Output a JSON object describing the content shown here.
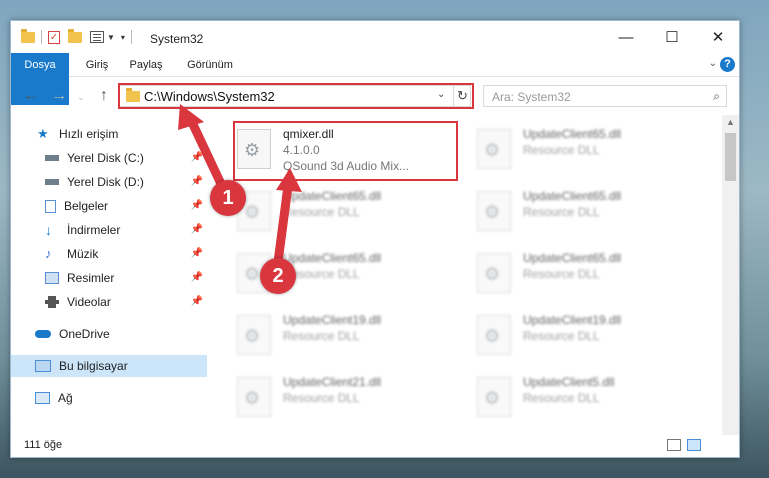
{
  "window": {
    "title": "System32",
    "controls": {
      "minimize": "—",
      "maximize": "☐",
      "close": "✕"
    }
  },
  "ribbon": {
    "tabs": [
      {
        "label": "Dosya",
        "active": true
      },
      {
        "label": "Giriş"
      },
      {
        "label": "Paylaş"
      },
      {
        "label": "Görünüm"
      }
    ],
    "help": "?"
  },
  "navigation": {
    "back": "←",
    "forward": "→",
    "up": "↑",
    "address": "C:\\Windows\\System32",
    "dropdown": "⌄",
    "refresh": "↻",
    "search_placeholder": "Ara: System32",
    "search_icon": "⌕"
  },
  "sidebar": {
    "items": [
      {
        "label": "Hızlı erişim",
        "icon": "star-icon",
        "color": "#1979ca",
        "pinned": false
      },
      {
        "label": "Yerel Disk (C:)",
        "icon": "drive-icon",
        "color": "#6d7f8c",
        "pinned": true
      },
      {
        "label": "Yerel Disk (D:)",
        "icon": "drive-icon",
        "color": "#6d7f8c",
        "pinned": true
      },
      {
        "label": "Belgeler",
        "icon": "document-icon",
        "color": "#5a8fd0",
        "pinned": true
      },
      {
        "label": "İndirmeler",
        "icon": "download-icon",
        "color": "#1979ca",
        "pinned": true
      },
      {
        "label": "Müzik",
        "icon": "music-icon",
        "color": "#3a7bd5",
        "pinned": true
      },
      {
        "label": "Resimler",
        "icon": "picture-icon",
        "color": "#5a8fd0",
        "pinned": true
      },
      {
        "label": "Videolar",
        "icon": "video-icon",
        "color": "#555555",
        "pinned": true
      },
      {
        "label": "OneDrive",
        "icon": "cloud-icon",
        "color": "#1979ca",
        "pinned": false
      },
      {
        "label": "Bu bilgisayar",
        "icon": "computer-icon",
        "color": "#4a90d9",
        "pinned": false,
        "selected": true
      },
      {
        "label": "Ağ",
        "icon": "network-icon",
        "color": "#4a90d9",
        "pinned": false
      }
    ]
  },
  "files": [
    {
      "name": "qmixer.dll",
      "version": "4.1.0.0",
      "desc": "QSound 3d Audio Mix...",
      "highlighted": true
    },
    {
      "name": "UpdateClient65.dll",
      "desc": "Resource DLL"
    },
    {
      "name": "UpdateClient65.dll",
      "desc": "Resource DLL"
    },
    {
      "name": "UpdateClient65.dll",
      "desc": "Resource DLL"
    },
    {
      "name": "UpdateClient65.dll",
      "desc": "Resource DLL"
    },
    {
      "name": "UpdateClient65.dll",
      "desc": "Resource DLL"
    },
    {
      "name": "UpdateClient19.dll",
      "desc": "Resource DLL"
    },
    {
      "name": "UpdateClient19.dll",
      "desc": "Resource DLL"
    },
    {
      "name": "UpdateClient21.dll",
      "desc": "Resource DLL"
    },
    {
      "name": "UpdateClient5.dll",
      "desc": "Resource DLL"
    }
  ],
  "status": {
    "count": "111 öğe"
  },
  "callouts": [
    {
      "label": "1"
    },
    {
      "label": "2"
    }
  ],
  "colors": {
    "accent": "#1979ca",
    "highlight": "#d9363e"
  }
}
